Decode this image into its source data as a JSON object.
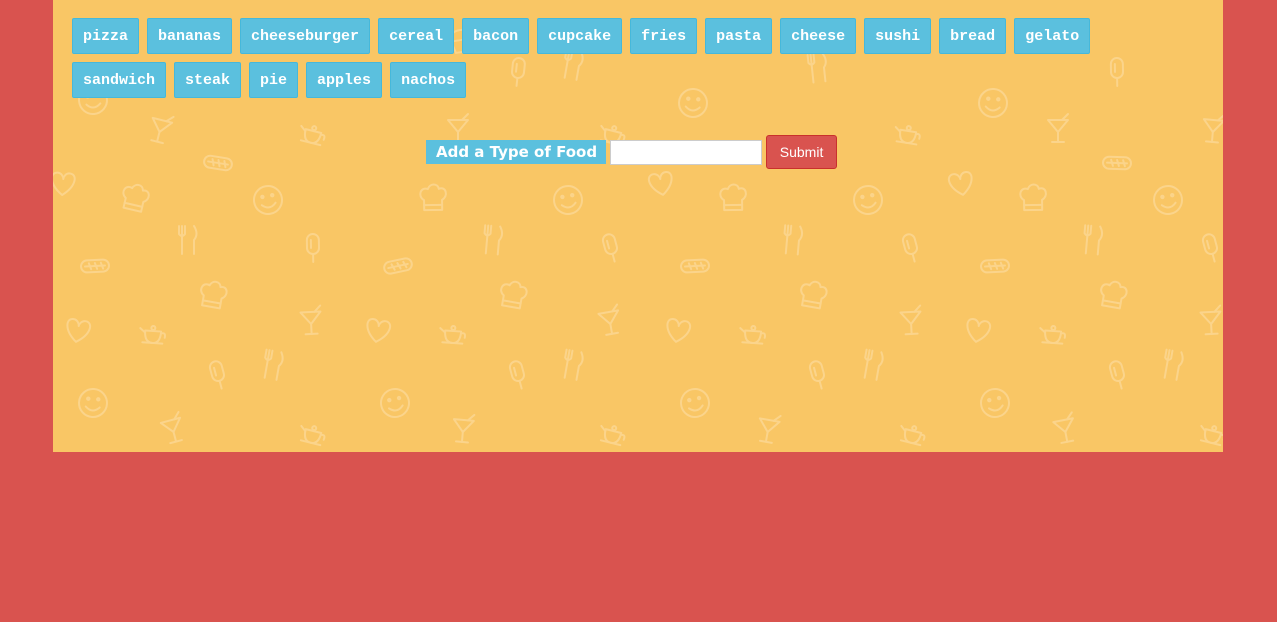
{
  "foods": [
    "pizza",
    "bananas",
    "cheeseburger",
    "cereal",
    "bacon",
    "cupcake",
    "fries",
    "pasta",
    "cheese",
    "sushi",
    "bread",
    "gelato",
    "sandwich",
    "steak",
    "pie",
    "apples",
    "nachos"
  ],
  "form": {
    "label": "Add a Type of Food",
    "input_value": "",
    "submit_label": "Submit"
  },
  "colors": {
    "page_background": "#d9534f",
    "panel_background": "#f9c665",
    "food_button": "#5bc0de",
    "submit_button": "#d9534f"
  }
}
